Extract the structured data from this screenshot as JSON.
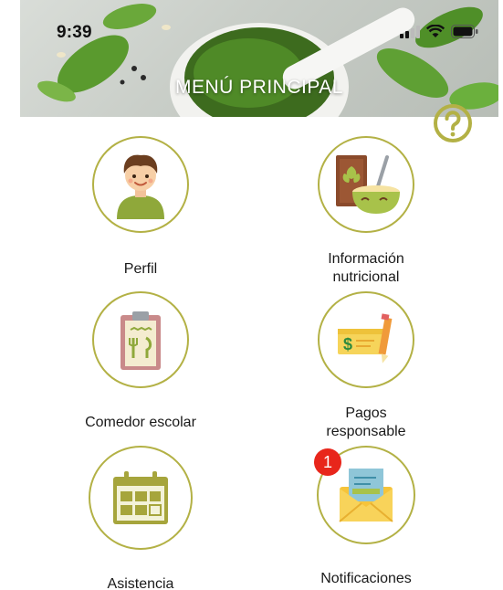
{
  "status_bar": {
    "time": "9:39"
  },
  "header": {
    "title": "MENÚ PRINCIPAL",
    "help_icon": "question-circle-icon"
  },
  "menu": {
    "items": [
      {
        "label": "Perfil",
        "icon": "child-avatar-icon"
      },
      {
        "label": "Información nutricional",
        "icon": "cereal-bowl-icon"
      },
      {
        "label": "Comedor escolar",
        "icon": "clipboard-menu-icon"
      },
      {
        "label": "Pagos responsable",
        "icon": "check-payment-icon"
      },
      {
        "label": "Asistencia",
        "icon": "calendar-icon"
      },
      {
        "label": "Notificaciones",
        "icon": "envelope-icon",
        "badge": "1"
      }
    ]
  },
  "colors": {
    "accent": "#b3b145",
    "badge": "#e8261b"
  }
}
